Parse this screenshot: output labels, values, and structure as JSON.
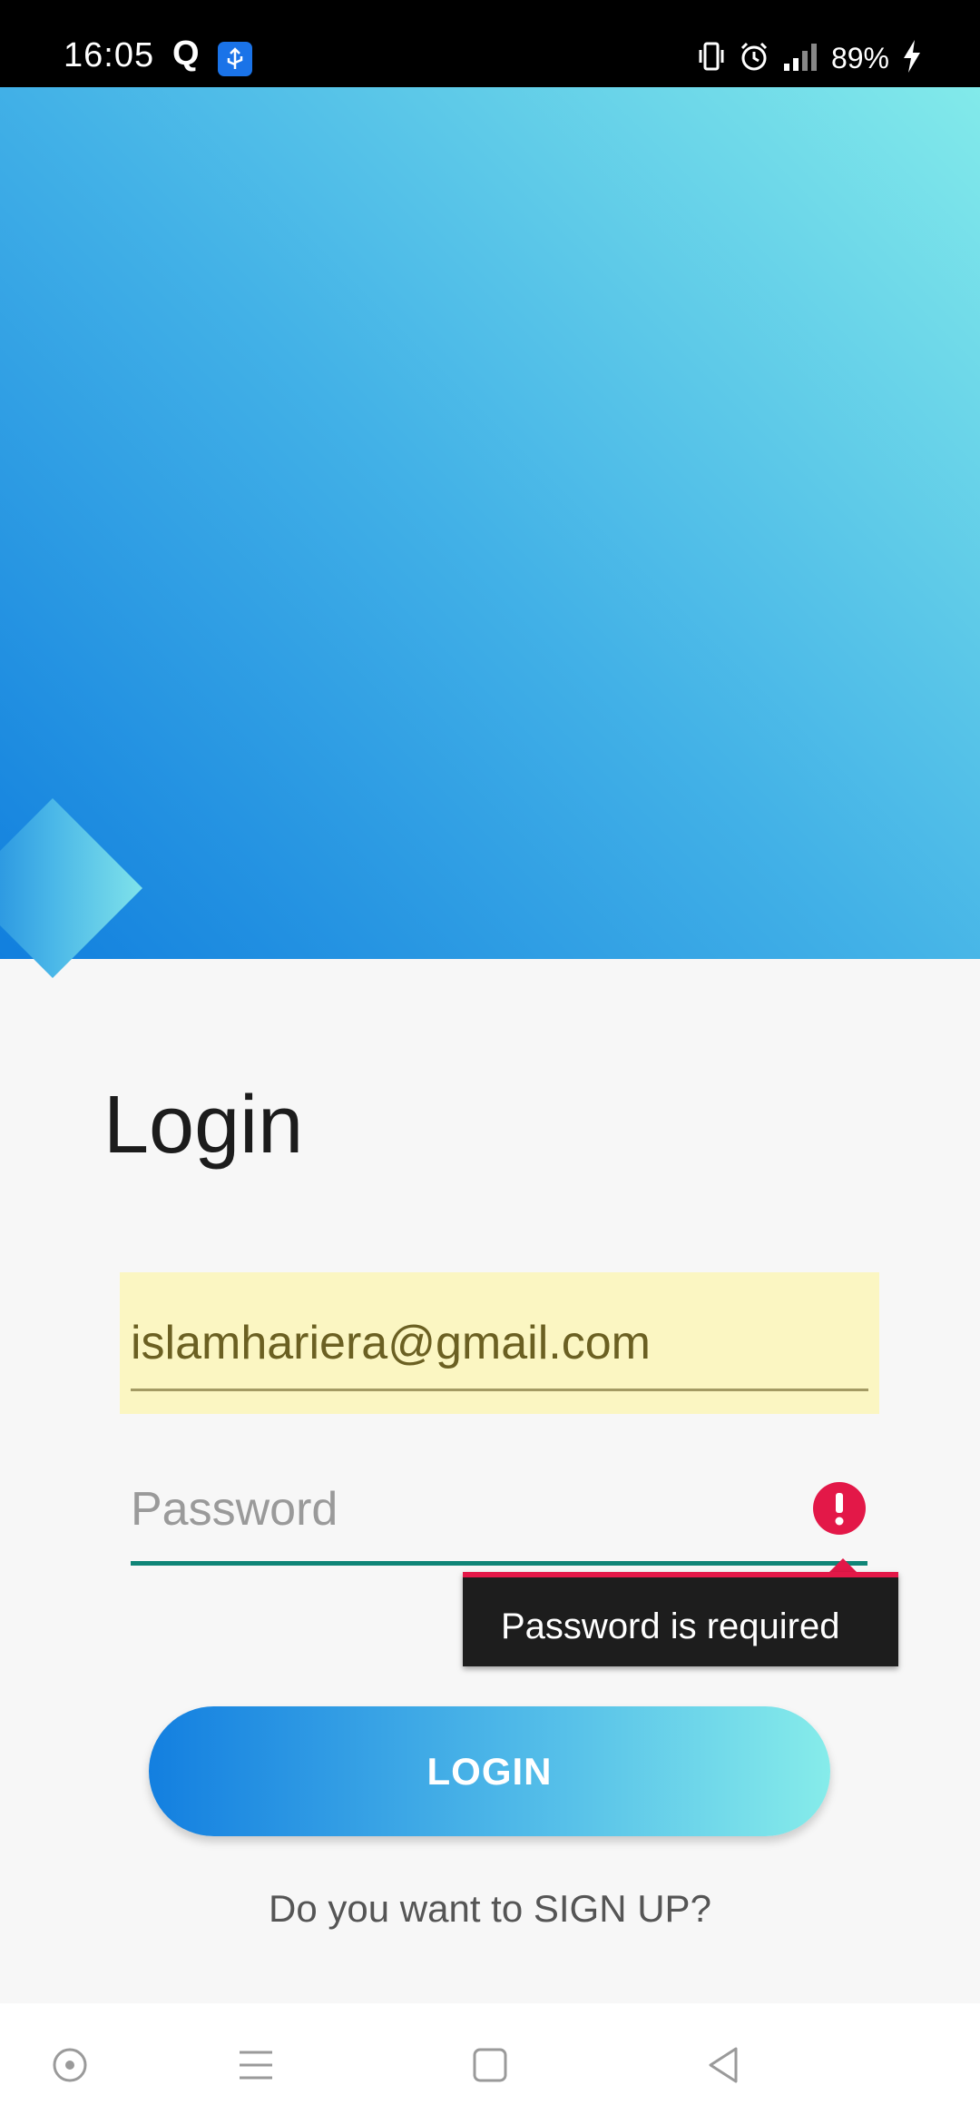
{
  "status_bar": {
    "time": "16:05",
    "app_icon_letter": "Q",
    "battery_percent": "89%",
    "icons": [
      "q-app-icon",
      "usb-icon",
      "vibrate-icon",
      "alarm-icon",
      "signal-icon",
      "charging-icon"
    ]
  },
  "login": {
    "title": "Login",
    "email_value": "islamhariera@gmail.com",
    "password_placeholder": "Password",
    "error_message": "Password is required",
    "button_label": "LOGIN",
    "signup_text": "Do you want to SIGN UP?"
  },
  "colors": {
    "accent": "#117fde",
    "gradient_end": "#82eaea",
    "error": "#e31848",
    "input_line": "#0f8577",
    "autofill_bg": "#fbf6c2"
  },
  "nav_bar": {
    "icons": [
      "circle-icon",
      "menu-icon",
      "home-square-icon",
      "back-triangle-icon"
    ]
  }
}
